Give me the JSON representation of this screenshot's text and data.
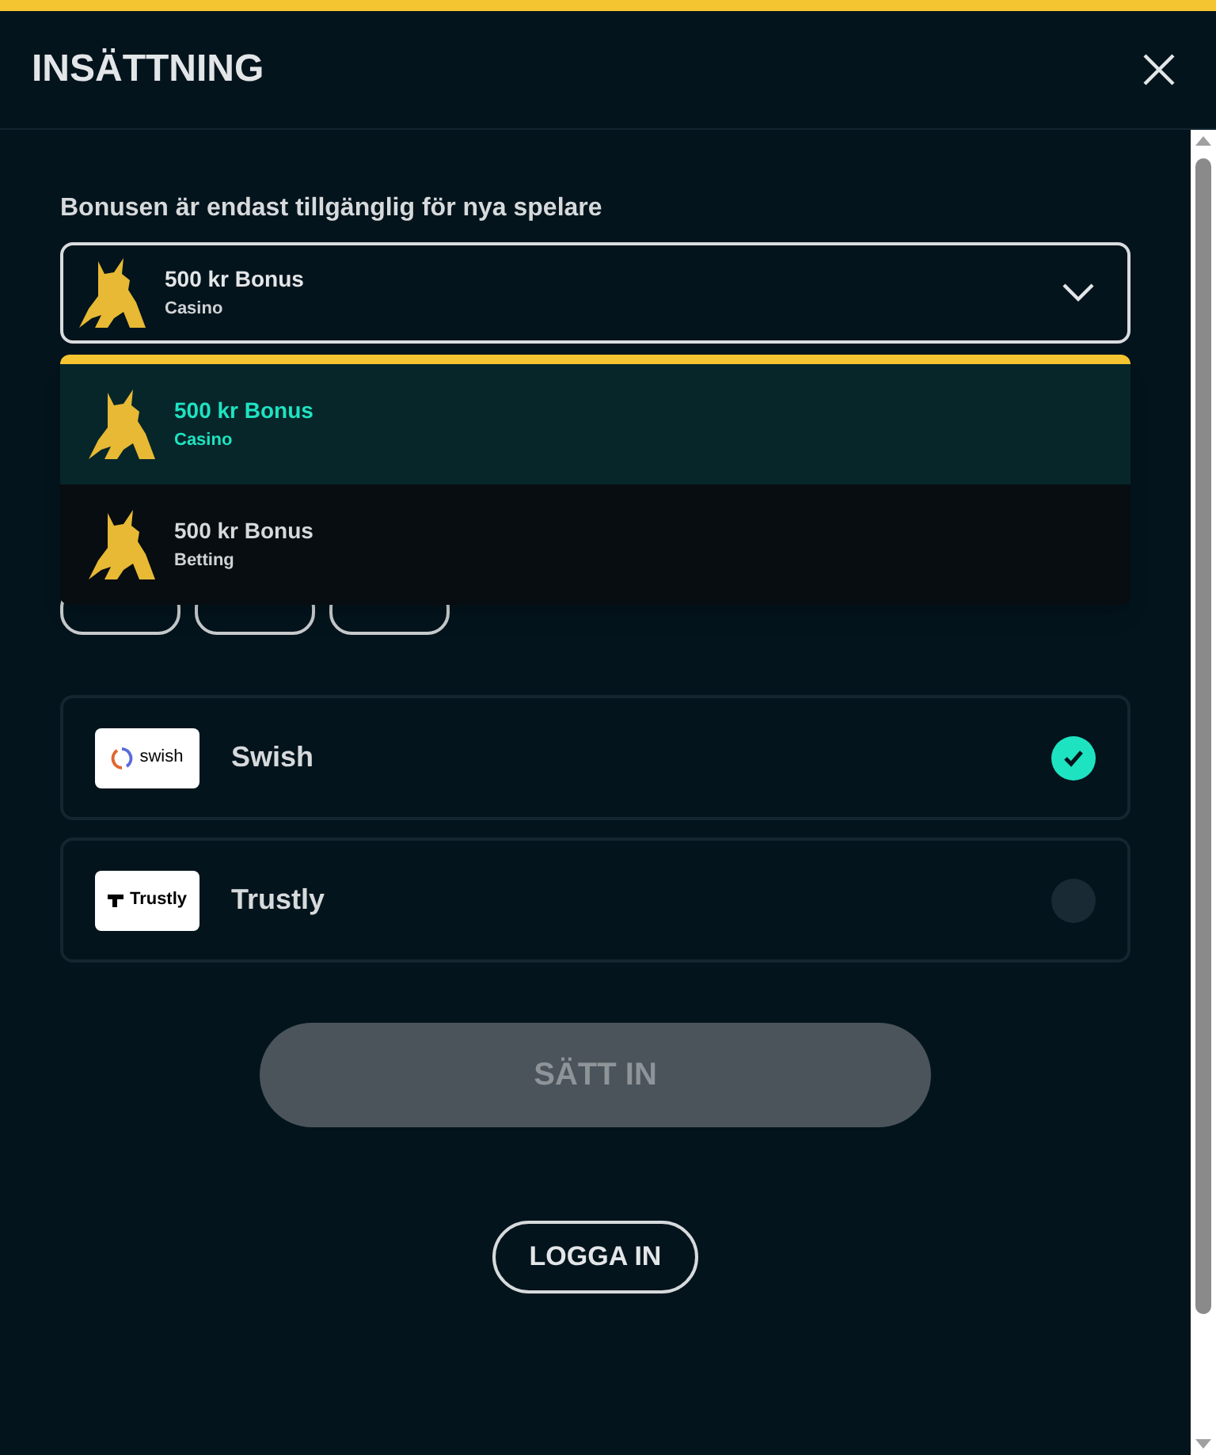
{
  "title": "INSÄTTNING",
  "bonus_label": "Bonusen är endast tillgänglig för nya spelare",
  "bonus_select": {
    "title": "500 kr Bonus",
    "subtitle": "Casino",
    "expanded": true
  },
  "bonus_options": [
    {
      "title": "500 kr Bonus",
      "subtitle": "Casino",
      "selected": true
    },
    {
      "title": "500 kr Bonus",
      "subtitle": "Betting",
      "selected": false
    }
  ],
  "payment_methods": [
    {
      "logo": "swish",
      "kind": "swish",
      "name": "Swish",
      "selected": true
    },
    {
      "logo": "Trustly",
      "kind": "trustly",
      "name": "Trustly",
      "selected": false
    }
  ],
  "deposit_button": {
    "label": "SÄTT IN",
    "disabled": true
  },
  "login_button": {
    "label": "LOGGA IN"
  }
}
